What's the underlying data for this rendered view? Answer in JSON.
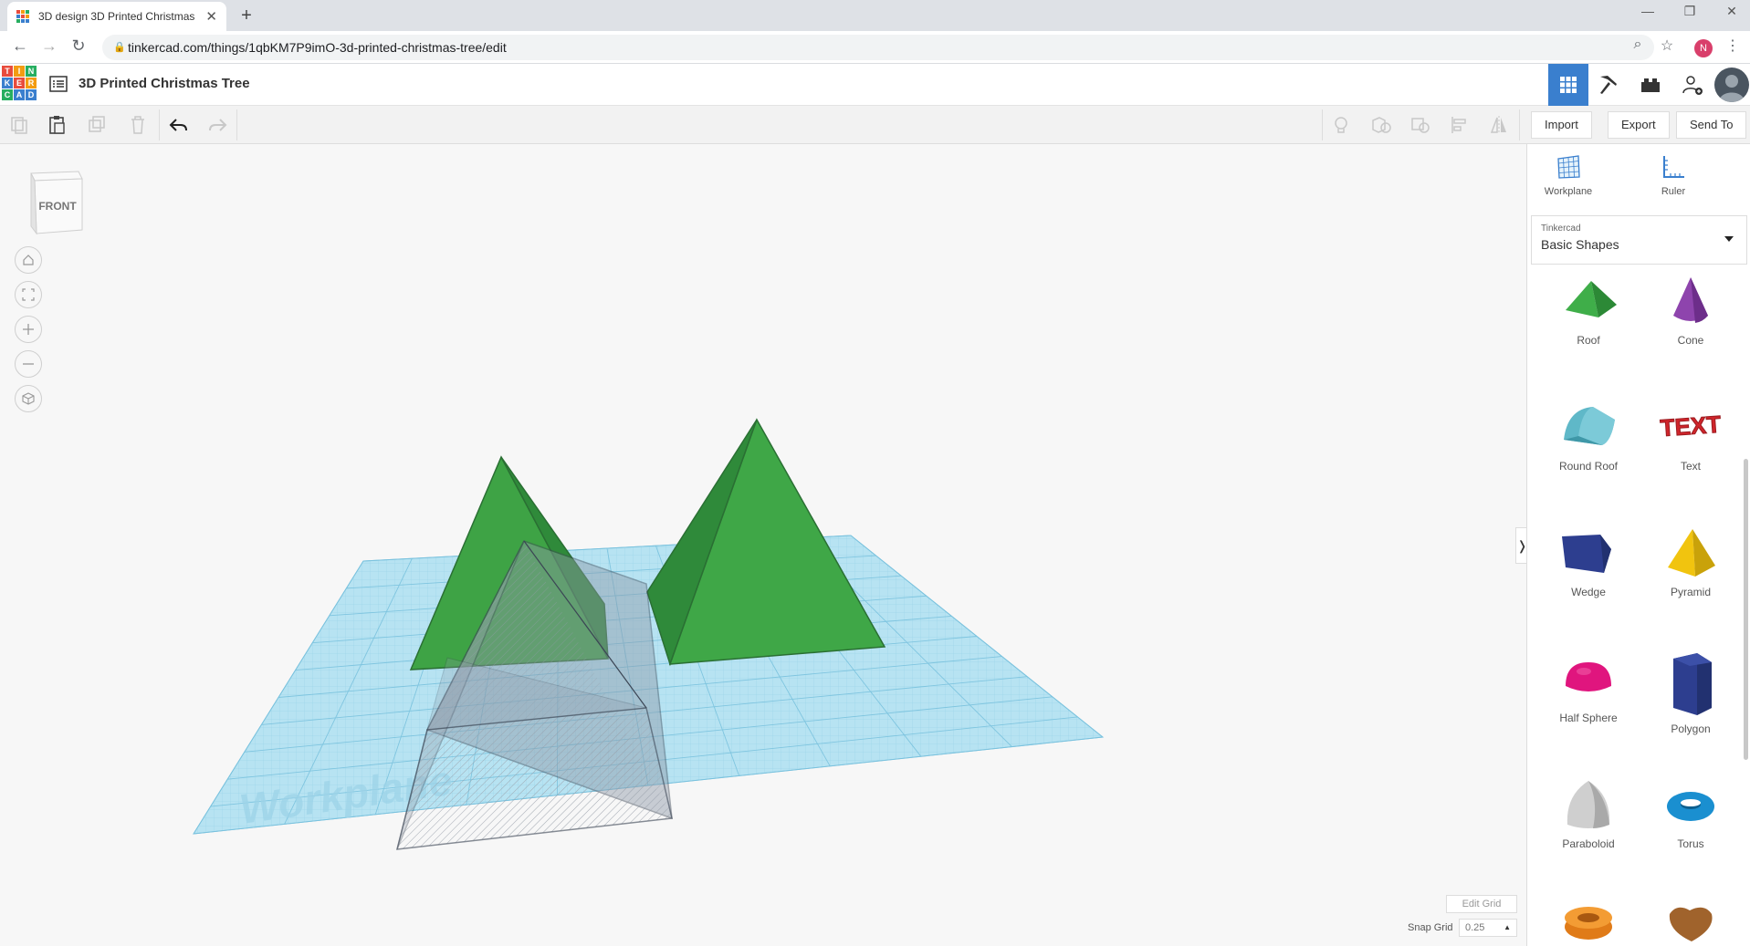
{
  "browser": {
    "tab_title": "3D design 3D Printed Christmas",
    "tab_close": "✕",
    "new_tab": "+",
    "url": "tinkercad.com/things/1qbKM7P9imO-3d-printed-christmas-tree/edit",
    "profile_initial": "N",
    "window_controls": {
      "minimize": "—",
      "restore": "❐",
      "close": "✕"
    },
    "nav": {
      "back": "←",
      "forward": "→",
      "reload": "↻"
    }
  },
  "app": {
    "logo_letters": [
      "T",
      "I",
      "N",
      "K",
      "E",
      "R",
      "C",
      "A",
      "D"
    ],
    "logo_colors": [
      "#e84c3d",
      "#f39c12",
      "#27ae60",
      "#3a7fce",
      "#e84c3d",
      "#f39c12",
      "#27ae60",
      "#3a7fce",
      "#3a7fce"
    ],
    "design_title": "3D Printed Christmas Tree",
    "accent_color": "#3a7fce"
  },
  "toolbar": {
    "import_label": "Import",
    "export_label": "Export",
    "send_to_label": "Send To"
  },
  "viewport": {
    "viewcube_label": "FRONT",
    "view_buttons": [
      "home-view",
      "fit-all",
      "zoom-in",
      "zoom-out",
      "ortho-view"
    ],
    "edit_grid_label": "Edit Grid",
    "snap_grid_label": "Snap Grid",
    "snap_grid_value": "0.25",
    "workplane_text": "Workplane",
    "collapse_arrow": "❭"
  },
  "panel": {
    "workplane_label": "Workplane",
    "ruler_label": "Ruler",
    "library_sub": "Tinkercad",
    "library_main": "Basic Shapes",
    "shapes": [
      {
        "label": "Roof",
        "icon": "roof-shape-icon",
        "color": "#3fae49"
      },
      {
        "label": "Cone",
        "icon": "cone-shape-icon",
        "color": "#8e44ad"
      },
      {
        "label": "Round Roof",
        "icon": "round-roof-shape-icon",
        "color": "#5fb8c8"
      },
      {
        "label": "Text",
        "icon": "text-shape-icon",
        "color": "#d0252b"
      },
      {
        "label": "Wedge",
        "icon": "wedge-shape-icon",
        "color": "#2d3e8f"
      },
      {
        "label": "Pyramid",
        "icon": "pyramid-shape-icon",
        "color": "#f1c40f"
      },
      {
        "label": "Half Sphere",
        "icon": "half-sphere-shape-icon",
        "color": "#e0157e"
      },
      {
        "label": "Polygon",
        "icon": "polygon-shape-icon",
        "color": "#2d3e8f"
      },
      {
        "label": "Paraboloid",
        "icon": "paraboloid-shape-icon",
        "color": "#cfcfcf"
      },
      {
        "label": "Torus",
        "icon": "torus-shape-icon",
        "color": "#1a8fd0"
      }
    ]
  }
}
